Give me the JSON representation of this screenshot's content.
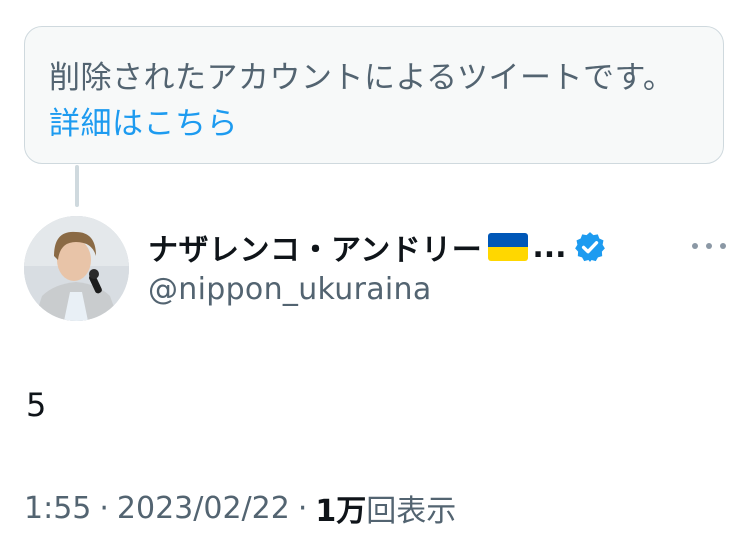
{
  "notice": {
    "text": "削除されたアカウントによるツイートです。",
    "link": "詳細はこちら"
  },
  "author": {
    "display_name": "ナザレンコ・アンドリー",
    "ellipsis": "...",
    "handle": "@nippon_ukuraina",
    "flag": "ukraine-flag",
    "verified": true
  },
  "tweet": {
    "text": "5",
    "time": "1:55",
    "date": "2023/02/22",
    "views_count": "1万",
    "views_label": "回表示",
    "separator": "·"
  },
  "colors": {
    "link": "#1d9bf0",
    "secondary_text": "#536471",
    "primary_text": "#0f1419",
    "notice_bg": "#f7f9f9",
    "border": "#cfd9de",
    "verified": "#1d9bf0",
    "flag_blue": "#0057b7",
    "flag_yellow": "#ffd700"
  }
}
